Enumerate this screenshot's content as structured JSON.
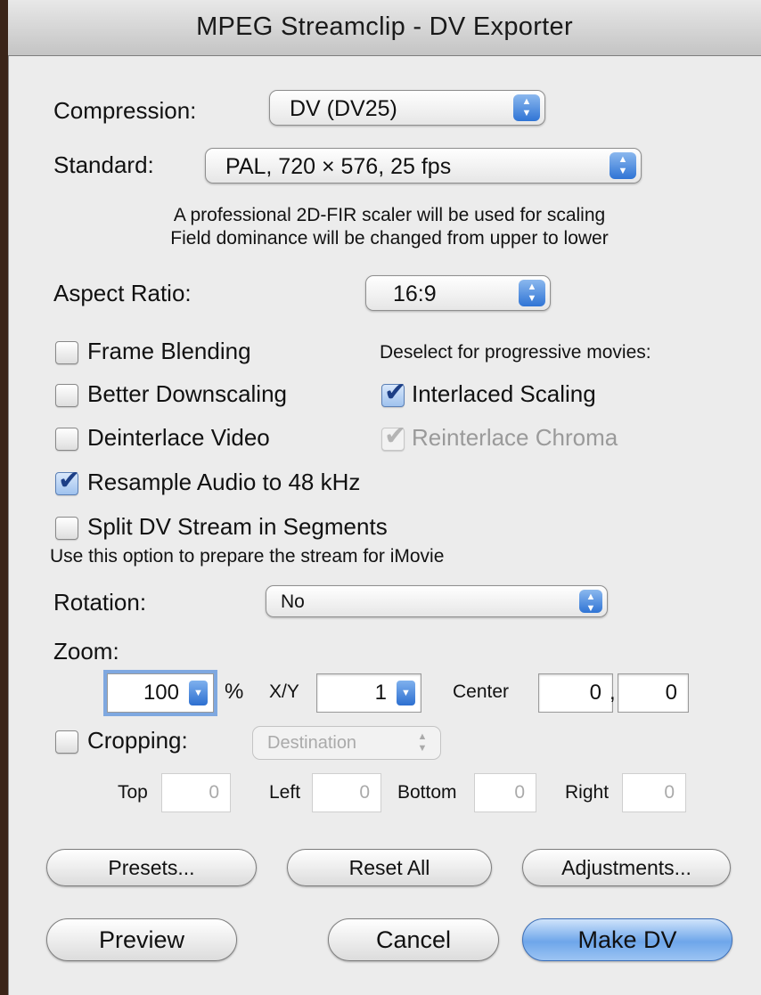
{
  "window": {
    "title": "MPEG Streamclip - DV Exporter"
  },
  "compression": {
    "label": "Compression:",
    "value": "DV (DV25)"
  },
  "standard": {
    "label": "Standard:",
    "value": "PAL, 720 × 576, 25 fps",
    "note_line1": "A professional 2D-FIR scaler will be used for scaling",
    "note_line2": "Field dominance will be changed from upper to lower"
  },
  "aspect_ratio": {
    "label": "Aspect Ratio:",
    "value": "16:9"
  },
  "options": {
    "frame_blending": {
      "label": "Frame Blending",
      "checked": false
    },
    "better_downscaling": {
      "label": "Better Downscaling",
      "checked": false
    },
    "deinterlace_video": {
      "label": "Deinterlace Video",
      "checked": false
    },
    "resample_audio": {
      "label": "Resample Audio to 48 kHz",
      "checked": true
    },
    "split_dv": {
      "label": "Split DV Stream in Segments",
      "checked": false
    },
    "split_note": "Use this option to prepare the stream for iMovie",
    "progressive_note": "Deselect for progressive movies:",
    "interlaced_scaling": {
      "label": "Interlaced Scaling",
      "checked": true
    },
    "reinterlace_chroma": {
      "label": "Reinterlace Chroma",
      "checked": true,
      "enabled": false
    }
  },
  "rotation": {
    "label": "Rotation:",
    "value": "No"
  },
  "zoom": {
    "label": "Zoom:",
    "value": "100",
    "percent": "%",
    "xy_label": "X/Y",
    "xy_value": "1",
    "center_label": "Center",
    "center_x": "0",
    "center_sep": ",",
    "center_y": "0"
  },
  "cropping": {
    "label": "Cropping:",
    "checked": false,
    "mode": "Destination",
    "top_label": "Top",
    "top": "0",
    "left_label": "Left",
    "left": "0",
    "bottom_label": "Bottom",
    "bottom": "0",
    "right_label": "Right",
    "right": "0"
  },
  "buttons": {
    "presets": "Presets...",
    "reset_all": "Reset All",
    "adjustments": "Adjustments...",
    "preview": "Preview",
    "cancel": "Cancel",
    "make_dv": "Make DV"
  },
  "colors": {
    "accent": "#3a7bd5",
    "default_button": "#6ea6ea"
  },
  "icons": {
    "popup_arrows": "⬍",
    "combo_arrow": "▼",
    "checkmark": "✔"
  }
}
